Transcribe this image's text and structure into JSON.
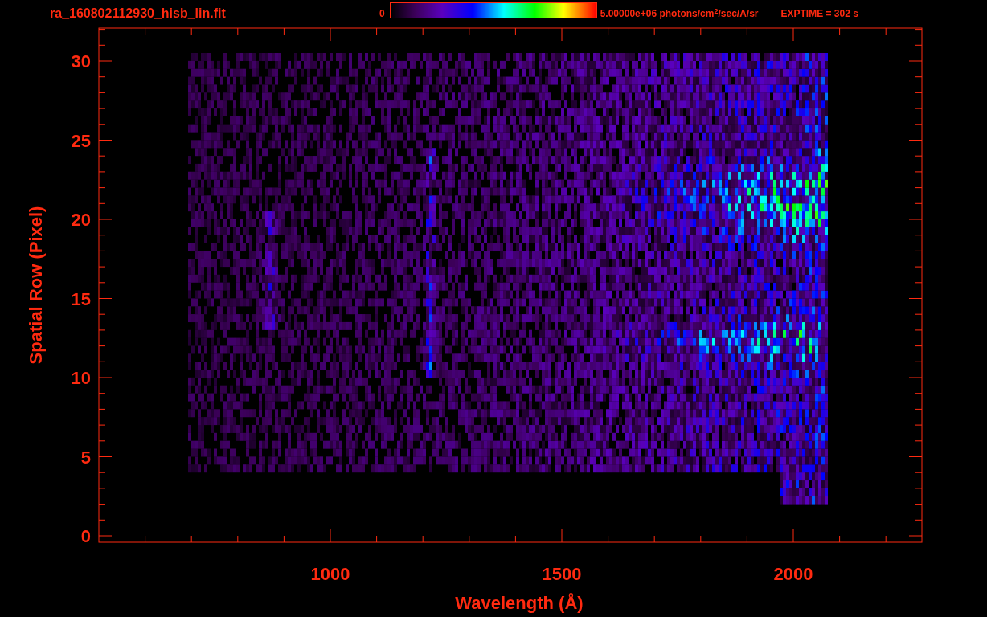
{
  "header": {
    "title": "ra_160802112930_hisb_lin.fit",
    "colorbar_min": "0",
    "colorbar_max": "5.00000e+06 photons/cm$^{2}$/sec/A/sr",
    "exptime": "EXPTIME = 302 s"
  },
  "plot": {
    "xlabel": "Wavelength (Å)",
    "ylabel": "Spatial Row (Pixel)",
    "xtick_labels": [
      "1000",
      "1500",
      "2000"
    ],
    "ytick_labels": [
      "30",
      "25",
      "20",
      "15",
      "10",
      "5",
      "0"
    ]
  }
}
